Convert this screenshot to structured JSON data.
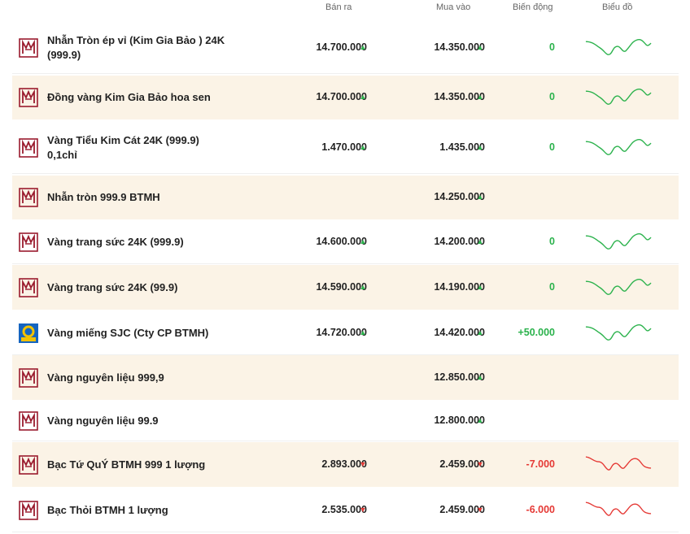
{
  "header": {
    "sell": "Bán ra",
    "buy": "Mua vào",
    "change": "Biến động",
    "chart": "Biểu đồ"
  },
  "colors": {
    "up": "#2bb24c",
    "down": "#e53935",
    "brand": "#9a1b2e",
    "shade": "#fbf3e6"
  },
  "rows": [
    {
      "name": "Nhẫn Tròn ép vỉ (Kim Gia Bảo ) 24K (999.9)",
      "sell": "14.700.000",
      "sell_dir": "up",
      "buy": "14.350.000",
      "buy_dir": "up",
      "change": "0",
      "change_dir": "up",
      "chart": "up",
      "logo": "btmh-logo",
      "shade": false
    },
    {
      "name": "Đồng vàng Kim Gia Bảo hoa sen",
      "sell": "14.700.000",
      "sell_dir": "up",
      "buy": "14.350.000",
      "buy_dir": "up",
      "change": "0",
      "change_dir": "up",
      "chart": "up",
      "logo": "btmh-logo",
      "shade": true
    },
    {
      "name": "Vàng Tiểu Kim Cát 24K (999.9) 0,1chỉ",
      "sell": "1.470.000",
      "sell_dir": "up",
      "buy": "1.435.000",
      "buy_dir": "up",
      "change": "0",
      "change_dir": "up",
      "chart": "up",
      "logo": "btmh-logo",
      "shade": false
    },
    {
      "name": "Nhẫn tròn 999.9 BTMH",
      "sell": "",
      "sell_dir": "",
      "buy": "14.250.000",
      "buy_dir": "up",
      "change": "",
      "change_dir": "",
      "chart": "",
      "logo": "btmh-logo",
      "shade": true
    },
    {
      "name": "Vàng trang sức 24K (999.9)",
      "sell": "14.600.000",
      "sell_dir": "up",
      "buy": "14.200.000",
      "buy_dir": "up",
      "change": "0",
      "change_dir": "up",
      "chart": "up",
      "logo": "btmh-logo",
      "shade": false
    },
    {
      "name": "Vàng trang sức 24K (99.9)",
      "sell": "14.590.000",
      "sell_dir": "up",
      "buy": "14.190.000",
      "buy_dir": "up",
      "change": "0",
      "change_dir": "up",
      "chart": "up",
      "logo": "btmh-logo",
      "shade": true
    },
    {
      "name": "Vàng miếng SJC (Cty CP BTMH)",
      "sell": "14.720.000",
      "sell_dir": "up",
      "buy": "14.420.000",
      "buy_dir": "up",
      "change": "+50.000",
      "change_dir": "up",
      "chart": "up",
      "logo": "sjc-logo",
      "shade": false
    },
    {
      "name": "Vàng nguyên liệu 999,9",
      "sell": "",
      "sell_dir": "",
      "buy": "12.850.000",
      "buy_dir": "up",
      "change": "",
      "change_dir": "",
      "chart": "",
      "logo": "btmh-logo",
      "shade": true
    },
    {
      "name": "Vàng nguyên liệu 99.9",
      "sell": "",
      "sell_dir": "",
      "buy": "12.800.000",
      "buy_dir": "up",
      "change": "",
      "change_dir": "",
      "chart": "",
      "logo": "btmh-logo",
      "shade": false
    },
    {
      "name": "Bạc Tứ QuÝ BTMH 999 1 lượng",
      "sell": "2.893.000",
      "sell_dir": "down",
      "buy": "2.459.000",
      "buy_dir": "down",
      "change": "-7.000",
      "change_dir": "down",
      "chart": "down",
      "logo": "btmh-logo",
      "shade": true
    },
    {
      "name": "Bạc Thỏi BTMH 1 lượng",
      "sell": "2.535.000",
      "sell_dir": "down",
      "buy": "2.459.000",
      "buy_dir": "down",
      "change": "-6.000",
      "change_dir": "down",
      "chart": "down",
      "logo": "btmh-logo",
      "shade": false
    }
  ]
}
